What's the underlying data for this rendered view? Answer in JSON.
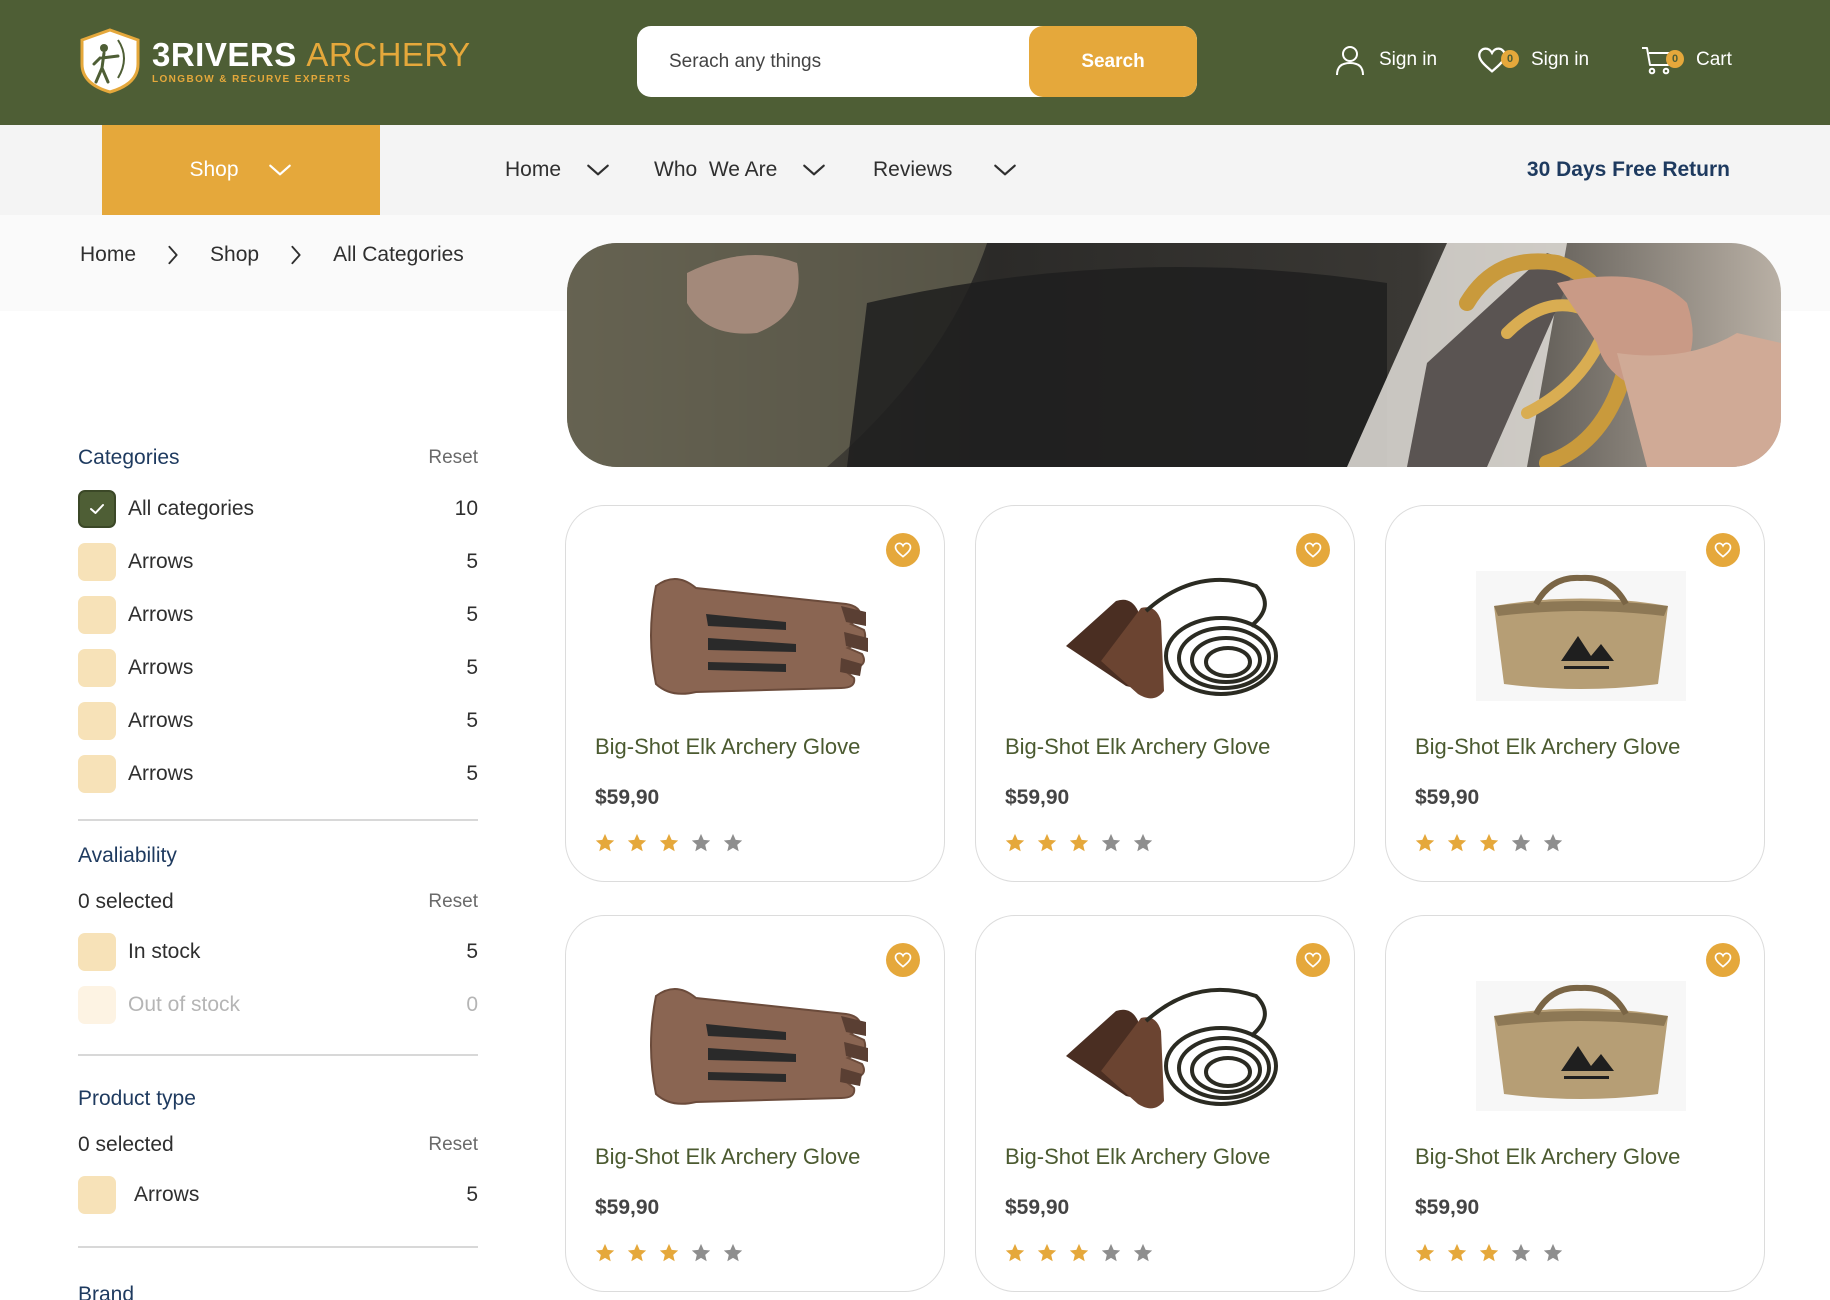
{
  "brand": {
    "name_part1": "3RIVERS",
    "name_part2": "ARCHERY",
    "tagline": "LONGBOW & RECURVE EXPERTS",
    "colors": {
      "header_green": "#4e5e35",
      "accent_gold": "#e5a83b",
      "navy": "#1e3a5f"
    }
  },
  "search": {
    "placeholder": "Serach any things",
    "button_label": "Search"
  },
  "header_actions": {
    "account_label": "Sign in",
    "wishlist_label": "Sign in",
    "wishlist_count": "0",
    "cart_label": "Cart",
    "cart_count": "0"
  },
  "nav": {
    "shop_label": "Shop",
    "items": [
      {
        "label": "Home"
      },
      {
        "label": "Who  We Are"
      },
      {
        "label": "Reviews"
      }
    ],
    "promo": "30 Days Free Return"
  },
  "breadcrumb": [
    "Home",
    "Shop",
    "All Categories"
  ],
  "filters": {
    "categories": {
      "title": "Categories",
      "reset": "Reset",
      "options": [
        {
          "label": "All categories",
          "count": "10",
          "checked": true
        },
        {
          "label": "Arrows",
          "count": "5",
          "checked": false
        },
        {
          "label": "Arrows",
          "count": "5",
          "checked": false
        },
        {
          "label": "Arrows",
          "count": "5",
          "checked": false
        },
        {
          "label": "Arrows",
          "count": "5",
          "checked": false
        },
        {
          "label": "Arrows",
          "count": "5",
          "checked": false
        }
      ]
    },
    "availability": {
      "title": "Avaliability",
      "selected_text": "0 selected",
      "reset": "Reset",
      "options": [
        {
          "label": "In stock",
          "count": "5"
        },
        {
          "label": "Out of stock",
          "count": "0",
          "disabled": true
        }
      ]
    },
    "product_type": {
      "title": "Product type",
      "selected_text": "0 selected",
      "reset": "Reset",
      "options": [
        {
          "label": "Arrows",
          "count": "5"
        }
      ]
    },
    "brand": {
      "title": "Brand"
    }
  },
  "products": [
    {
      "name": "Big-Shot Elk Archery Glove",
      "price": "$59,90",
      "rating": 3,
      "max_rating": 5,
      "image": "glove-image"
    },
    {
      "name": "Big-Shot Elk Archery Glove",
      "price": "$59,90",
      "rating": 3,
      "max_rating": 5,
      "image": "finger-tab-image"
    },
    {
      "name": "Big-Shot Elk Archery Glove",
      "price": "$59,90",
      "rating": 3,
      "max_rating": 5,
      "image": "bag-image"
    },
    {
      "name": "Big-Shot Elk Archery Glove",
      "price": "$59,90",
      "rating": 3,
      "max_rating": 5,
      "image": "glove-image"
    },
    {
      "name": "Big-Shot Elk Archery Glove",
      "price": "$59,90",
      "rating": 3,
      "max_rating": 5,
      "image": "finger-tab-image"
    },
    {
      "name": "Big-Shot Elk Archery Glove",
      "price": "$59,90",
      "rating": 3,
      "max_rating": 5,
      "image": "bag-image"
    }
  ]
}
